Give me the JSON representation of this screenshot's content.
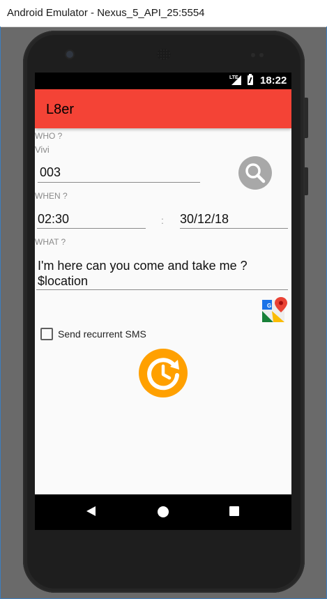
{
  "window": {
    "title": "Android Emulator - Nexus_5_API_25:5554"
  },
  "status_bar": {
    "network": "LTE",
    "time": "18:22"
  },
  "app": {
    "title": "L8er"
  },
  "who": {
    "label": "WHO ?",
    "contact_name": "Vivi",
    "phone_value": "003"
  },
  "when": {
    "label": "WHEN ?",
    "time_value": "02:30",
    "separator": ":",
    "date_value": "30/12/18"
  },
  "what": {
    "label": "WHAT ?",
    "message_line1": "I'm here can you come and take me ?",
    "message_line2": "$location"
  },
  "recurrent": {
    "label": "Send recurrent SMS",
    "checked": false
  },
  "colors": {
    "accent": "#f44336",
    "fab": "#ffa000",
    "search": "#a8a8a8"
  },
  "icons": {
    "search": "search-icon",
    "maps": "google-maps-icon",
    "schedule": "schedule-icon"
  }
}
